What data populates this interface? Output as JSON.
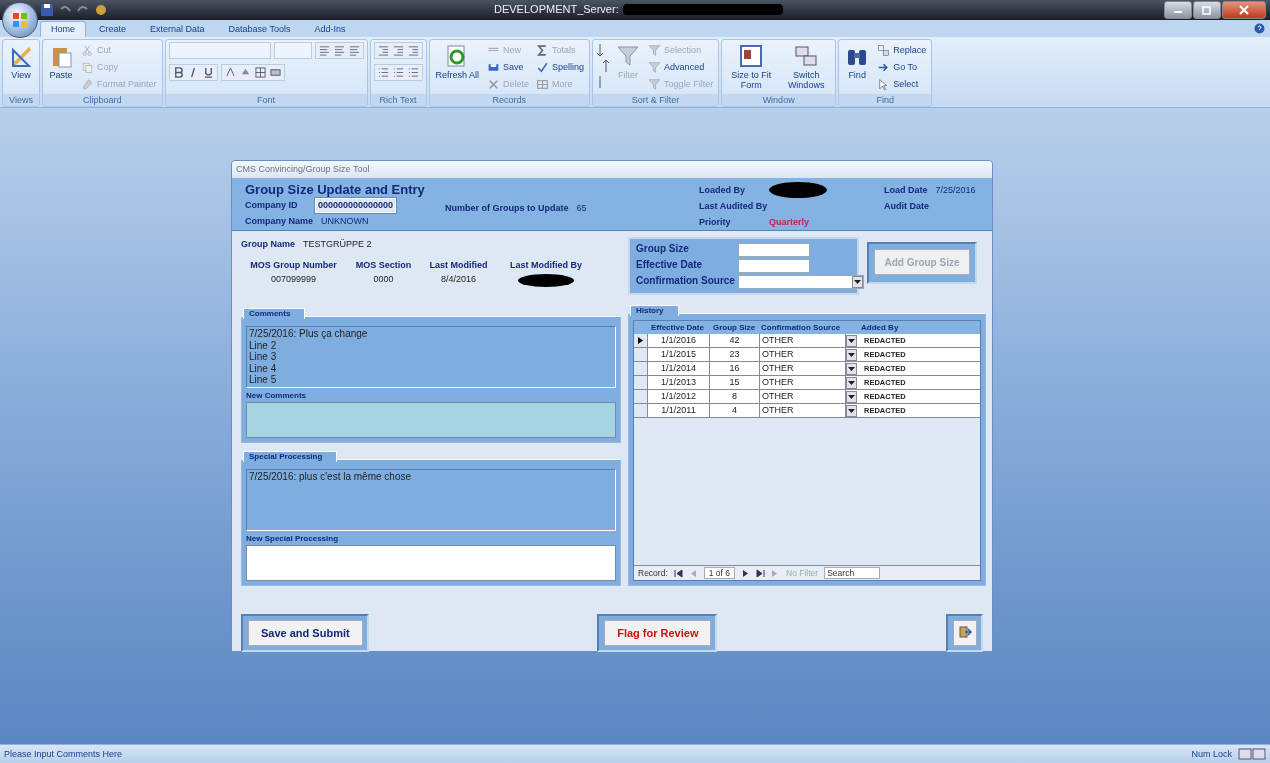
{
  "window": {
    "title": "DEVELOPMENT_Server:"
  },
  "ribbon_tabs": [
    {
      "label": "Home",
      "selected": true
    },
    {
      "label": "Create",
      "selected": false
    },
    {
      "label": "External Data",
      "selected": false
    },
    {
      "label": "Database Tools",
      "selected": false
    },
    {
      "label": "Add-Ins",
      "selected": false
    }
  ],
  "ribbon_groups": [
    {
      "label": "Views",
      "kind": "plain",
      "items": [
        {
          "kind": "large",
          "label": "View",
          "disabled": false
        }
      ]
    },
    {
      "label": "Clipboard",
      "kind": "plain",
      "items": [
        {
          "kind": "large",
          "label": "Paste",
          "disabled": false
        },
        {
          "kind": "small",
          "label": "Cut",
          "disabled": true
        },
        {
          "kind": "small",
          "label": "Copy",
          "disabled": true
        },
        {
          "kind": "small",
          "label": "Format Painter",
          "disabled": true
        }
      ]
    },
    {
      "label": "Font",
      "kind": "font"
    },
    {
      "label": "Rich Text",
      "kind": "richtext"
    },
    {
      "label": "Records",
      "kind": "plain",
      "items": [
        {
          "kind": "large",
          "label": "Refresh All",
          "disabled": false
        },
        {
          "kind": "small",
          "label": "New",
          "disabled": true
        },
        {
          "kind": "small",
          "label": "Save",
          "disabled": false
        },
        {
          "kind": "small",
          "label": "Delete",
          "disabled": true
        },
        {
          "kind": "small",
          "label": "Totals",
          "disabled": true
        },
        {
          "kind": "small",
          "label": "Spelling",
          "disabled": false
        },
        {
          "kind": "small",
          "label": "More",
          "disabled": true
        }
      ]
    },
    {
      "label": "Sort & Filter",
      "kind": "sortfilter",
      "items": [
        {
          "kind": "large",
          "label": "Filter",
          "disabled": true
        },
        {
          "kind": "small",
          "label": "Selection",
          "disabled": true
        },
        {
          "kind": "small",
          "label": "Advanced",
          "disabled": false
        },
        {
          "kind": "small",
          "label": "Toggle Filter",
          "disabled": true
        }
      ]
    },
    {
      "label": "Window",
      "kind": "plain",
      "items": [
        {
          "kind": "large",
          "label": "Size to Fit Form",
          "disabled": false
        },
        {
          "kind": "large",
          "label": "Switch Windows",
          "disabled": false
        }
      ]
    },
    {
      "label": "Find",
      "kind": "plain",
      "items": [
        {
          "kind": "large",
          "label": "Find",
          "disabled": false
        },
        {
          "kind": "small",
          "label": "Replace",
          "disabled": false
        },
        {
          "kind": "small",
          "label": "Go To",
          "disabled": false
        },
        {
          "kind": "small",
          "label": "Select",
          "disabled": false
        }
      ]
    }
  ],
  "form": {
    "title": "CMS Convincing/Group Size Tool",
    "heading": "Group Size Update and Entry",
    "company_id": {
      "label": "Company ID",
      "value": "000000000000000"
    },
    "company_name": {
      "label": "Company Name",
      "value": "UNKNOWN"
    },
    "groups_to_update": {
      "label": "Number of Groups to Update",
      "value": "65"
    },
    "loaded_by": {
      "label": "Loaded By"
    },
    "last_audited_by": {
      "label": "Last Audited By"
    },
    "priority": {
      "label": "Priority",
      "value": "Quarterly"
    },
    "load_date": {
      "label": "Load Date",
      "value": "7/25/2016"
    },
    "audit_date": {
      "label": "Audit Date"
    },
    "group_name": {
      "label": "Group Name",
      "value": "TESTGRÜPPE 2"
    },
    "details": [
      {
        "label": "MOS Group Number",
        "value": "007099999"
      },
      {
        "label": "MOS Section",
        "value": "0000"
      },
      {
        "label": "Last Modified",
        "value": "8/4/2016"
      },
      {
        "label": "Last Modified By"
      }
    ],
    "entry": {
      "fields": [
        {
          "label": "Group Size",
          "kind": "text"
        },
        {
          "label": "Effective Date",
          "kind": "text"
        },
        {
          "label": "Confirmation Source",
          "kind": "combo"
        }
      ],
      "button": {
        "label": "Add Group Size",
        "disabled": true
      }
    },
    "comments": {
      "tab": "Comments",
      "lines": [
        "7/25/2016: Plus ça change",
        "Line 2",
        "Line 3",
        "Line 4",
        "Line 5"
      ],
      "new_label": "New Comments"
    },
    "special": {
      "tab": "Special Processing",
      "lines": [
        "7/25/2016: plus c'est la même chose"
      ],
      "new_label": "New Special Processing"
    },
    "history": {
      "tab": "History",
      "columns": [
        "Effective Date",
        "Group Size",
        "Confirmation Source",
        "Added By"
      ],
      "rows": [
        {
          "date": "1/1/2016",
          "size": "42",
          "source": "OTHER",
          "added_by": "REDACTED",
          "selected": true
        },
        {
          "date": "1/1/2015",
          "size": "23",
          "source": "OTHER",
          "added_by": "REDACTED",
          "selected": false
        },
        {
          "date": "1/1/2014",
          "size": "16",
          "source": "OTHER",
          "added_by": "REDACTED",
          "selected": false
        },
        {
          "date": "1/1/2013",
          "size": "15",
          "source": "OTHER",
          "added_by": "REDACTED",
          "selected": false
        },
        {
          "date": "1/1/2012",
          "size": "8",
          "source": "OTHER",
          "added_by": "REDACTED",
          "selected": false
        },
        {
          "date": "1/1/2011",
          "size": "4",
          "source": "OTHER",
          "added_by": "REDACTED",
          "selected": false
        }
      ],
      "nav": {
        "label": "Record:",
        "position": "1 of 6",
        "filter": "No Filter",
        "search": "Search"
      }
    },
    "buttons": [
      {
        "label": "Save and Submit",
        "kind": "save"
      },
      {
        "label": "Flag for Review",
        "kind": "flag"
      },
      {
        "kind": "exit"
      }
    ]
  },
  "status_bar": {
    "message": "Please Input Comments Here",
    "indicator": "Num Lock"
  }
}
